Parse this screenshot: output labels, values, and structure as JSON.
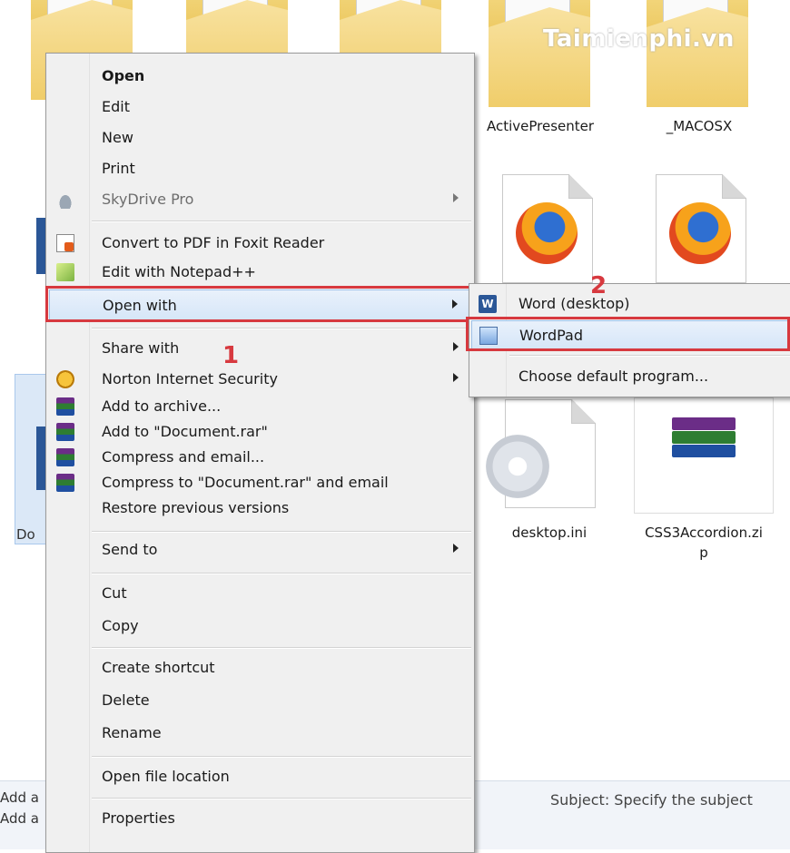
{
  "watermark": "Taimienphi.vn",
  "files": {
    "activepresenter": "ActivePresenter",
    "macosx": "_MACOSX",
    "desktop_ini": "desktop.ini",
    "css3_line1": "CSS3Accordion.zi",
    "css3_line2": "p"
  },
  "left_fragments": {
    "doc_tile": "Do",
    "add1": "Add a",
    "add2": "Add a"
  },
  "details": {
    "subject": "Subject:  Specify the subject"
  },
  "context_menu": {
    "items": [
      {
        "label": "Open",
        "icon": "",
        "bold": true
      },
      {
        "label": "Edit",
        "icon": ""
      },
      {
        "label": "New",
        "icon": ""
      },
      {
        "label": "Print",
        "icon": ""
      },
      {
        "label": "SkyDrive Pro",
        "icon": "skydrive-icon",
        "disabled": true,
        "submenu": true
      },
      {
        "label": "Convert to PDF in Foxit Reader",
        "icon": "foxit-pdf-icon"
      },
      {
        "label": "Edit with Notepad++",
        "icon": "notepad-plus-plus-icon"
      },
      {
        "label": "Open with",
        "icon": "",
        "submenu": true,
        "highlighted": true
      },
      {
        "label": "Share with",
        "icon": "",
        "submenu": true
      },
      {
        "label": "Norton Internet Security",
        "icon": "norton-icon",
        "submenu": true
      },
      {
        "label": "Add to archive...",
        "icon": "winrar-icon"
      },
      {
        "label": "Add to \"Document.rar\"",
        "icon": "winrar-icon"
      },
      {
        "label": "Compress and email...",
        "icon": "winrar-icon"
      },
      {
        "label": "Compress to \"Document.rar\" and email",
        "icon": "winrar-icon"
      },
      {
        "label": "Restore previous versions",
        "icon": ""
      },
      {
        "label": "Send to",
        "icon": "",
        "submenu": true
      },
      {
        "label": "Cut",
        "icon": ""
      },
      {
        "label": "Copy",
        "icon": ""
      },
      {
        "label": "Create shortcut",
        "icon": ""
      },
      {
        "label": "Delete",
        "icon": ""
      },
      {
        "label": "Rename",
        "icon": ""
      },
      {
        "label": "Open file location",
        "icon": ""
      },
      {
        "label": "Properties",
        "icon": ""
      }
    ]
  },
  "open_with_submenu": {
    "items": [
      {
        "label": "Word (desktop)",
        "icon": "word-icon"
      },
      {
        "label": "WordPad",
        "icon": "wordpad-icon",
        "highlighted": true
      },
      {
        "label": "Choose default program...",
        "icon": ""
      }
    ]
  },
  "annotations": {
    "marker1": "1",
    "marker2": "2"
  },
  "colors": {
    "annotation_red": "#d7393f",
    "highlight_blue": "#d6e6f8",
    "menu_bg": "#f0f0f0"
  }
}
